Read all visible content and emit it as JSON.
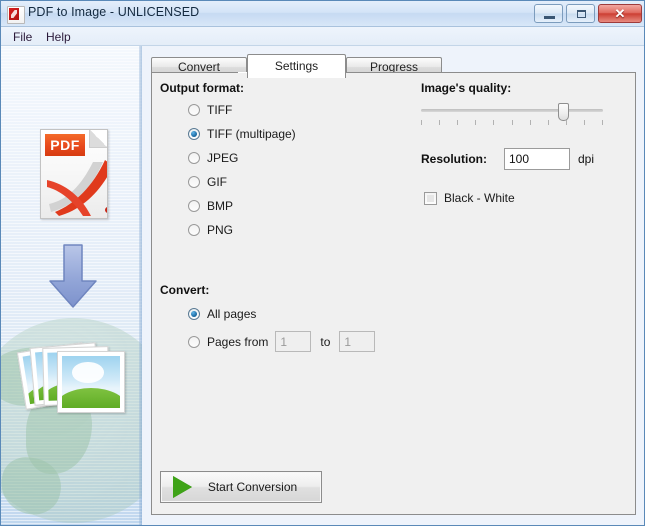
{
  "window": {
    "title": "PDF to Image - UNLICENSED",
    "icon": "pdf-document-icon",
    "minimize_label": "",
    "maximize_label": "",
    "close_label": "✕"
  },
  "menu": {
    "items": [
      {
        "label": "File"
      },
      {
        "label": "Help"
      }
    ]
  },
  "sidebar": {
    "pdf_icon_label": "PDF",
    "arrow_icon": "down-arrow-icon",
    "photos_icon": "photo-stack-icon",
    "globe_icon": "globe-watermark"
  },
  "tabs": [
    {
      "label": "Convert",
      "active": false
    },
    {
      "label": "Settings",
      "active": true
    },
    {
      "label": "Progress",
      "active": false
    }
  ],
  "settings": {
    "output_format": {
      "label": "Output format:",
      "selected": "TIFF (multipage)",
      "options": [
        {
          "label": "TIFF",
          "checked": false
        },
        {
          "label": "TIFF (multipage)",
          "checked": true
        },
        {
          "label": "JPEG",
          "checked": false
        },
        {
          "label": "GIF",
          "checked": false
        },
        {
          "label": "BMP",
          "checked": false
        },
        {
          "label": "PNG",
          "checked": false
        }
      ]
    },
    "quality": {
      "label": "Image's quality:",
      "value": 8,
      "min": 0,
      "max": 10,
      "tick_count": 11
    },
    "resolution": {
      "label": "Resolution:",
      "value": "100",
      "unit": "dpi"
    },
    "black_white": {
      "label": "Black - White",
      "checked": false
    },
    "convert": {
      "label": "Convert:",
      "selected": "All pages",
      "options": [
        {
          "label": "All pages",
          "checked": true
        },
        {
          "label": "Pages from",
          "checked": false
        }
      ],
      "page_from": "1",
      "page_to": "1",
      "to_label": "to"
    },
    "start_button": {
      "label": "Start Conversion",
      "icon": "play-icon"
    }
  },
  "colors": {
    "accent_blue": "#1e6fa8",
    "pdf_red": "#e8491c",
    "play_green": "#3fa318",
    "close_red": "#cc3f33",
    "panel_bg": "#f0f0f0",
    "sidebar_bg": "#dfeaf6"
  }
}
